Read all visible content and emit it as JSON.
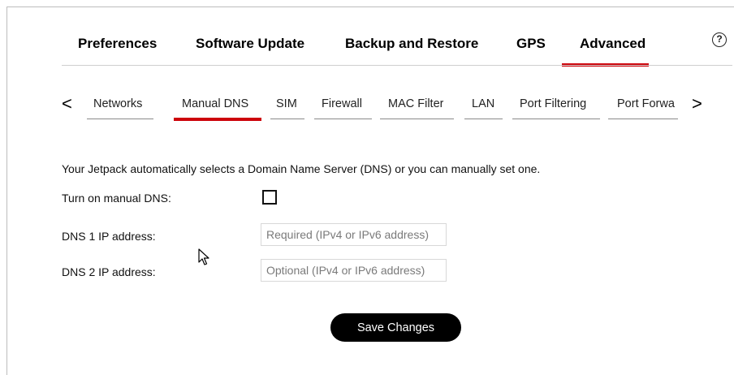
{
  "top_tabs": [
    {
      "label": "Preferences"
    },
    {
      "label": "Software Update"
    },
    {
      "label": "Backup and Restore"
    },
    {
      "label": "GPS"
    },
    {
      "label": "Advanced",
      "active": true
    }
  ],
  "help_icon": {
    "glyph": "?"
  },
  "sub_nav": {
    "prev": "<",
    "next": ">",
    "tabs": [
      {
        "label": "Networks"
      },
      {
        "label": "Manual DNS",
        "active": true
      },
      {
        "label": "SIM"
      },
      {
        "label": "Firewall"
      },
      {
        "label": "MAC Filter"
      },
      {
        "label": "LAN"
      },
      {
        "label": "Port Filtering"
      },
      {
        "label": "Port Forwa"
      }
    ]
  },
  "form": {
    "description": "Your Jetpack automatically selects a Domain Name Server (DNS) or you can manually set one.",
    "manual_dns_label": "Turn on manual DNS:",
    "manual_dns_checked": false,
    "dns1_label": "DNS 1 IP address:",
    "dns1_placeholder": "Required (IPv4 or IPv6 address)",
    "dns1_value": "",
    "dns2_label": "DNS 2 IP address:",
    "dns2_placeholder": "Optional (IPv4 or IPv6 address)",
    "dns2_value": "",
    "save_label": "Save Changes"
  },
  "colors": {
    "accent": "#cd040b",
    "button_bg": "#000000",
    "button_text": "#ffffff"
  }
}
